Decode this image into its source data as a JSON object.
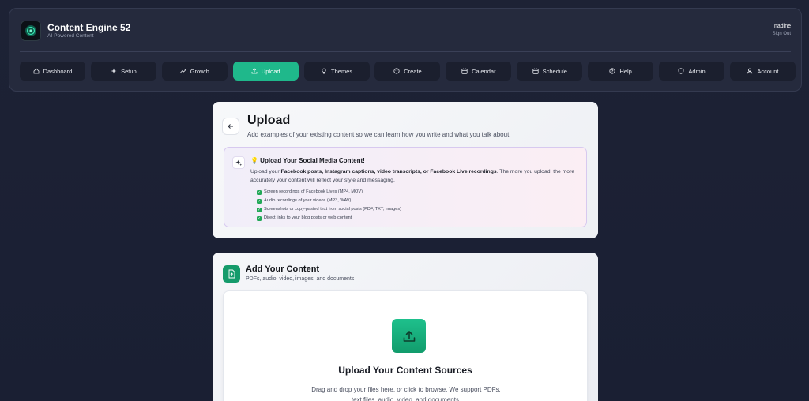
{
  "brand": {
    "title": "Content Engine 52",
    "subtitle": "AI-Powered Content"
  },
  "user": {
    "name": "nadine",
    "sign_out": "Sign Out"
  },
  "nav": [
    {
      "label": "Dashboard",
      "icon": "home-icon",
      "active": false
    },
    {
      "label": "Setup",
      "icon": "sparkles-icon",
      "active": false
    },
    {
      "label": "Growth",
      "icon": "trending-up-icon",
      "active": false
    },
    {
      "label": "Upload",
      "icon": "upload-icon",
      "active": true
    },
    {
      "label": "Themes",
      "icon": "lightbulb-icon",
      "active": false
    },
    {
      "label": "Create",
      "icon": "palette-icon",
      "active": false
    },
    {
      "label": "Calendar",
      "icon": "calendar-icon",
      "active": false
    },
    {
      "label": "Schedule",
      "icon": "calendar-clock-icon",
      "active": false
    },
    {
      "label": "Help",
      "icon": "help-circle-icon",
      "active": false
    },
    {
      "label": "Admin",
      "icon": "shield-icon",
      "active": false
    },
    {
      "label": "Account",
      "icon": "user-icon",
      "active": false
    }
  ],
  "upload_card": {
    "title": "Upload",
    "subtitle": "Add examples of your existing content so we can learn how you write and what you talk about.",
    "tip": {
      "title": "💡 Upload Your Social Media Content!",
      "text_prefix": "Upload your ",
      "text_bold": "Facebook posts, Instagram captions, video transcripts, or Facebook Live recordings",
      "text_suffix": ". The more you upload, the more accurately your content will reflect your style and messaging.",
      "items": [
        "Screen recordings of Facebook Lives (MP4, MOV)",
        "Audio recordings of your videos (MP3, WAV)",
        "Screenshots or copy-pasted text from social posts (PDF, TXT, Images)",
        "Direct links to your blog posts or web content"
      ]
    }
  },
  "content_card": {
    "title": "Add Your Content",
    "subtitle": "PDFs, audio, video, images, and documents",
    "dropzone_title": "Upload Your Content Sources",
    "dropzone_text": "Drag and drop your files here, or click to browse. We support PDFs, text files, audio, video, and documents."
  },
  "colors": {
    "accent": "#1fb88b",
    "background": "#1d2235",
    "nav_button": "#1b1f2e"
  }
}
